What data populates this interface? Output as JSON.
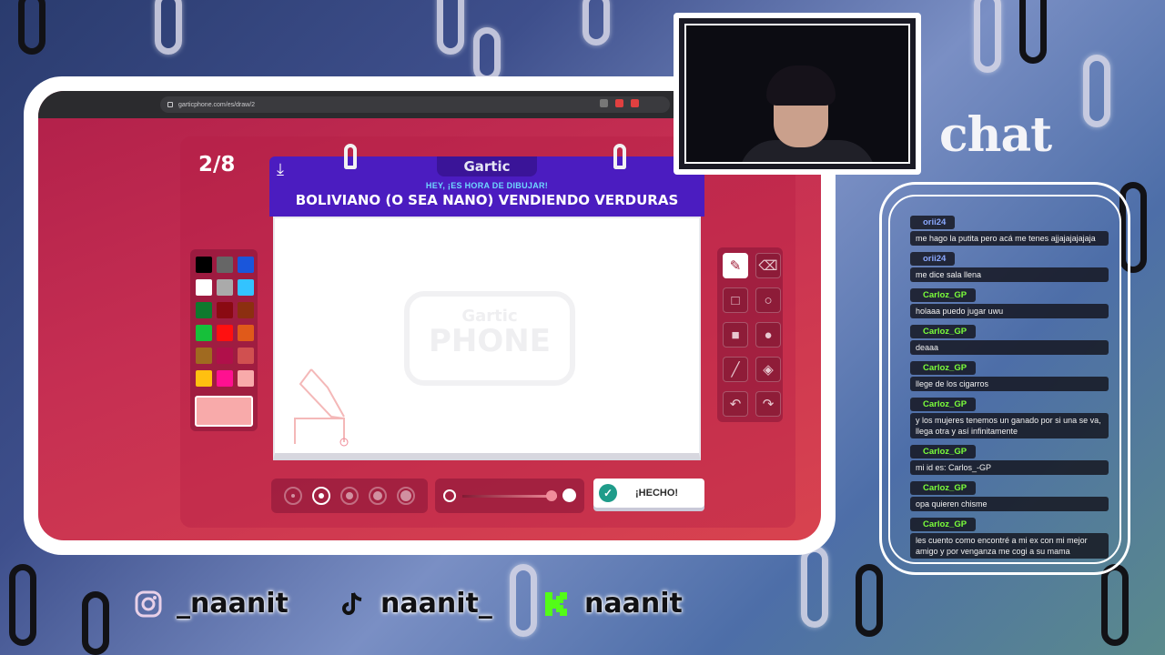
{
  "browser": {
    "url": "garticphone.com/es/draw/2"
  },
  "game": {
    "round": "2/8",
    "logo": "Gartic",
    "subtitle": "HEY, ¡ES HORA DE DIBUJAR!",
    "prompt": "BOLIVIANO (O SEA NANO) VENDIENDO VERDURAS",
    "watermark_line1": "Gartic",
    "watermark_line2": "PHONE",
    "done_label": "¡HECHO!",
    "palette": [
      "#000000",
      "#666666",
      "#1a56db",
      "#ffffff",
      "#aaaaaa",
      "#33c3ff",
      "#0e7a2e",
      "#8a0a12",
      "#8c2f10",
      "#16c03a",
      "#ff1010",
      "#e05a1a",
      "#a06a20",
      "#b0104a",
      "#d05050",
      "#ffc010",
      "#ff1090",
      "#f8aaaa"
    ],
    "selected_color": "#f8aaaa",
    "tools": [
      {
        "name": "pencil-tool",
        "glyph": "✎",
        "active": true
      },
      {
        "name": "eraser-tool",
        "glyph": "⌫",
        "active": false
      },
      {
        "name": "rectangle-outline-tool",
        "glyph": "□",
        "active": false
      },
      {
        "name": "ellipse-outline-tool",
        "glyph": "○",
        "active": false
      },
      {
        "name": "rectangle-fill-tool",
        "glyph": "■",
        "active": false
      },
      {
        "name": "ellipse-fill-tool",
        "glyph": "●",
        "active": false
      },
      {
        "name": "line-tool",
        "glyph": "╱",
        "active": false
      },
      {
        "name": "fill-bucket-tool",
        "glyph": "◈",
        "active": false
      },
      {
        "name": "undo-tool",
        "glyph": "↶",
        "active": false
      },
      {
        "name": "redo-tool",
        "glyph": "↷",
        "active": false
      }
    ],
    "selected_size_index": 1
  },
  "chat": {
    "title": "chat",
    "messages": [
      {
        "user": "orii24",
        "badge": true,
        "text": "me hago la putita pero acá me tenes ajjajajajajaja"
      },
      {
        "user": "orii24",
        "badge": true,
        "text": "me dice sala llena"
      },
      {
        "user": "Carloz_GP",
        "badge": false,
        "text": "holaaa puedo jugar uwu"
      },
      {
        "user": "Carloz_GP",
        "badge": false,
        "text": "deaaa"
      },
      {
        "user": "Carloz_GP",
        "badge": false,
        "text": "llege de los cigarros"
      },
      {
        "user": "Carloz_GP",
        "badge": false,
        "text": "y los mujeres tenemos un ganado por si una se va, llega otra y así infinitamente"
      },
      {
        "user": "Carloz_GP",
        "badge": false,
        "text": "mi id es: Carlos_-GP"
      },
      {
        "user": "Carloz_GP",
        "badge": false,
        "text": "opa quieren chisme"
      },
      {
        "user": "Carloz_GP",
        "badge": false,
        "text": "les cuento como encontré a mi ex con mi mejor amigo y por venganza me cogi a su mama"
      }
    ]
  },
  "socials": [
    {
      "icon": "instagram-icon",
      "handle": "_naanit"
    },
    {
      "icon": "tiktok-icon",
      "handle": "naanit_"
    },
    {
      "icon": "kick-icon",
      "handle": "naanit"
    }
  ],
  "colors": {
    "board_header": "#4b1cc0",
    "background_red": "#c52e52",
    "chat_username": "#7bff3a"
  }
}
